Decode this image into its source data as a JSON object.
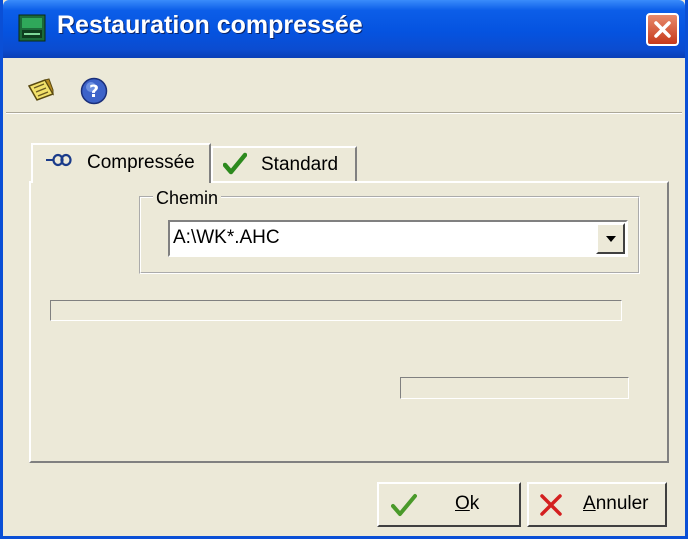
{
  "window": {
    "title": "Restauration compressée"
  },
  "toolbar": {
    "items": [
      {
        "icon": "notes-icon"
      },
      {
        "icon": "help-icon"
      }
    ]
  },
  "tabs": [
    {
      "label": "Compressée",
      "icon": "compressed-tab-icon",
      "selected": true
    },
    {
      "label": "Standard",
      "icon": "checkmark-icon",
      "selected": false
    }
  ],
  "path_group": {
    "label": "Chemin",
    "value": "A:\\WK*.AHC"
  },
  "buttons": {
    "ok_label": "Ok",
    "cancel_label": "Annuler"
  },
  "colors": {
    "titlebar": "#0553e0",
    "window_face": "#ece9d8",
    "close_button": "#c6391b",
    "ok_check": "#4a9a2a",
    "cancel_x": "#d42020"
  }
}
